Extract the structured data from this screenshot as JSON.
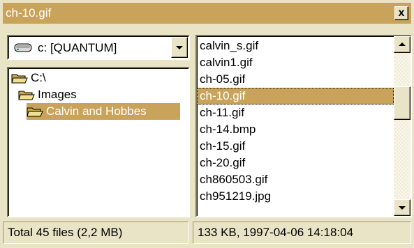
{
  "window": {
    "title": "ch-10.gif",
    "close_label": "x"
  },
  "drive": {
    "label": "c: [QUANTUM]",
    "icon": "hard-drive-icon"
  },
  "folders": [
    {
      "label": "C:\\",
      "icon": "open-folder-icon",
      "selected": false
    },
    {
      "label": "Images",
      "icon": "open-folder-icon",
      "selected": false
    },
    {
      "label": "Calvin and Hobbes",
      "icon": "open-folder-icon",
      "selected": true
    }
  ],
  "files": [
    "calvin_s.gif",
    "calvin1.gif",
    "ch-05.gif",
    "ch-10.gif",
    "ch-11.gif",
    "ch-14.bmp",
    "ch-15.gif",
    "ch-20.gif",
    "ch860503.gif",
    "ch951219.jpg"
  ],
  "selected_file": "ch-10.gif",
  "status": {
    "left": "Total 45 files (2,2 MB)",
    "right": "133 KB, 1997-04-06 14:18:04"
  },
  "colors": {
    "accent": "#c9a35a",
    "face": "#eae4c6"
  }
}
